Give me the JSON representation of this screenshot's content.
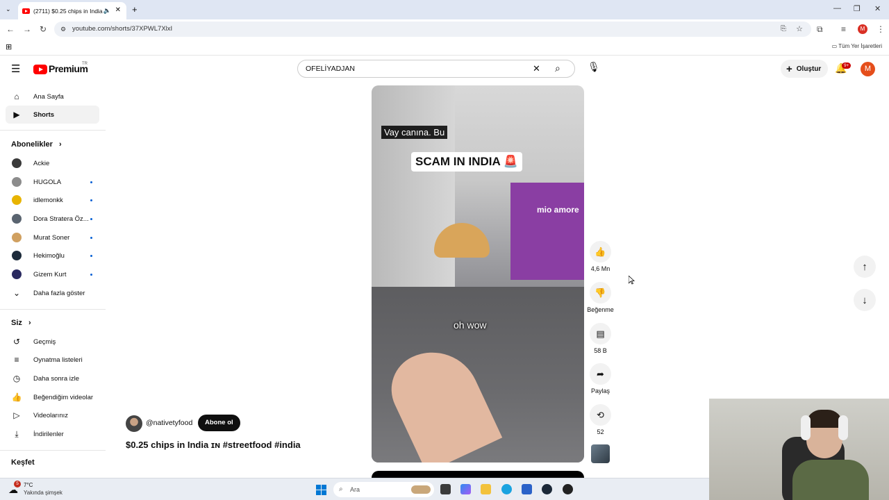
{
  "browser": {
    "tab_title": "(2711) $0.25 chips in India",
    "url": "youtube.com/shorts/37XPWL7XlxI",
    "bookmarks_all": "Tüm Yer İşaretleri",
    "profile_initial": "M"
  },
  "header": {
    "logo_text": "Premium",
    "country": "TR",
    "search_value": "OFELİYADJAN",
    "create_label": "Oluştur",
    "notif_count": "9+",
    "avatar_initial": "M"
  },
  "sidebar": {
    "main": [
      {
        "label": "Ana Sayfa",
        "icon": "home-icon"
      },
      {
        "label": "Shorts",
        "icon": "shorts-icon"
      }
    ],
    "subs_heading": "Abonelikler",
    "subs": [
      {
        "label": "Ackie",
        "color": "#3a3a3a",
        "dot": false
      },
      {
        "label": "HUGOLA",
        "color": "#8c8c8c",
        "dot": true
      },
      {
        "label": "idlemonkk",
        "color": "#e8b400",
        "dot": true
      },
      {
        "label": "Dora Stratera Öz...",
        "color": "#5a6470",
        "dot": true
      },
      {
        "label": "Murat Soner",
        "color": "#d0a060",
        "dot": true
      },
      {
        "label": "Hekimoğlu",
        "color": "#1c2a3a",
        "dot": true
      },
      {
        "label": "Gizem Kurt",
        "color": "#2a2a60",
        "dot": true
      }
    ],
    "show_more": "Daha fazla göster",
    "you_heading": "Siz",
    "you": [
      {
        "label": "Geçmiş",
        "icon": "history-icon"
      },
      {
        "label": "Oynatma listeleri",
        "icon": "playlist-icon"
      },
      {
        "label": "Daha sonra izle",
        "icon": "clock-icon"
      },
      {
        "label": "Beğendiğim videolar",
        "icon": "thumb-up-icon"
      },
      {
        "label": "Videolarınız",
        "icon": "video-icon"
      },
      {
        "label": "İndirilenler",
        "icon": "download-icon"
      }
    ],
    "explore_heading": "Keşfet"
  },
  "video": {
    "caption_top": "Vay canına.  Bu",
    "caption_title": "SCAM IN INDIA 🚨",
    "caption_bottom": "oh wow",
    "store_sign": "mio amore",
    "channel": "@nativetyfood",
    "subscribe": "Abone ol",
    "title": "$0.25 chips in India ɪɴ #streetfood #india"
  },
  "actions": {
    "likes": "4,6 Mn",
    "dislike": "Beğenme",
    "comments": "58 B",
    "share": "Paylaş",
    "remix": "52"
  },
  "taskbar": {
    "temp": "7°C",
    "weather": "Yakında şimşek",
    "weather_badge": "5",
    "search_placeholder": "Ara"
  }
}
